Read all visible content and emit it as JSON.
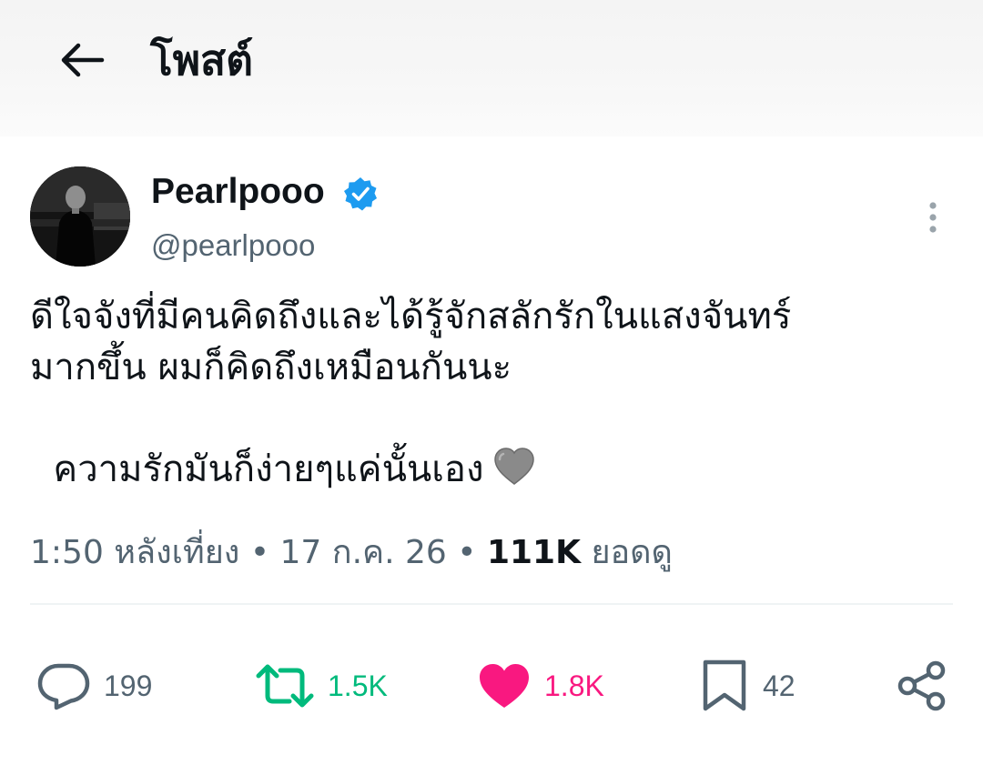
{
  "header": {
    "title": "โพสต์",
    "back_icon": "arrow-left-icon"
  },
  "author": {
    "display_name": "Pearlpooo",
    "handle": "@pearlpooo",
    "verified": true,
    "verified_color": "#1d9bf0"
  },
  "tweet": {
    "lines": [
      "ดีใจจังที่มีคนคิดถึงและได้รู้จักสลักรักในแสงจันทร์",
      "มากขึ้น  ผมก็คิดถึงเหมือนกันนะ",
      "",
      "  ความรักมันก็ง่ายๆแค่นั้นเอง"
    ],
    "emoji": "grey-heart-icon"
  },
  "meta": {
    "time": "1:50 หลังเที่ยง",
    "separator": "•",
    "date": "17 ก.ค. 26",
    "views_count": "111K",
    "views_label": "ยอดดู"
  },
  "actions": {
    "replies": "199",
    "reposts": "1.5K",
    "likes": "1.8K",
    "bookmarks": "42",
    "repost_color": "#00ba7c",
    "like_color": "#f91880",
    "neutral_color": "#536471"
  }
}
